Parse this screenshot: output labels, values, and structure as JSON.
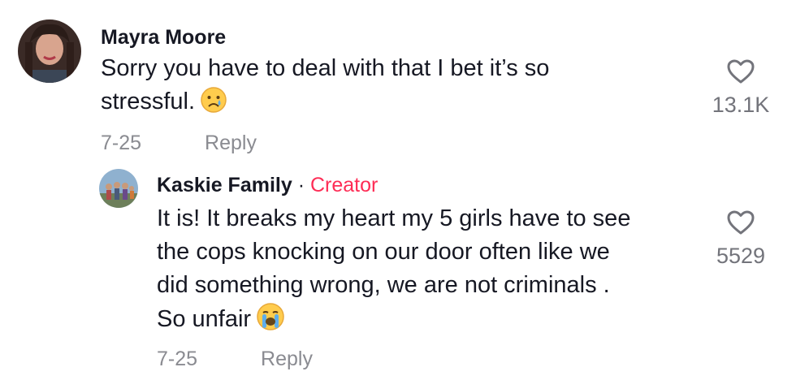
{
  "comments": [
    {
      "author": "Mayra Moore",
      "text_line1": "Sorry you have to deal with that I bet it’s so",
      "text_line2": "stressful.",
      "emoji": "sad-tear-face",
      "date": "7-25",
      "reply_label": "Reply",
      "likes": "13.1K",
      "icon": "heart-outline"
    },
    {
      "author": "Kaskie Family",
      "separator": " · ",
      "badge": "Creator",
      "text_lines": [
        "It is! It breaks my heart my 5 girls have to see",
        "the cops knocking on our door often like we",
        "did something wrong, we are not criminals .",
        "So unfair"
      ],
      "emoji": "loudly-crying-face",
      "date": "7-25",
      "reply_label": "Reply",
      "likes": "5529",
      "icon": "heart-outline"
    }
  ],
  "colors": {
    "text": "#161823",
    "muted": "#8a8b91",
    "creator": "#fe2c55"
  }
}
